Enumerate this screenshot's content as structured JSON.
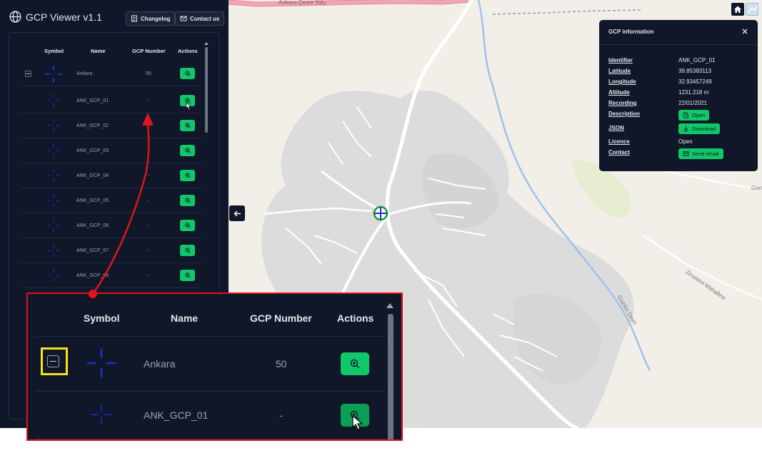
{
  "app": {
    "title": "GCP Viewer v1.1",
    "changelog_label": "Changelog",
    "contact_label": "Contact us"
  },
  "table": {
    "headers": [
      "Symbol",
      "Name",
      "GCP Number",
      "Actions"
    ],
    "group": {
      "name": "Ankara",
      "count": "50",
      "expanded": true
    },
    "rows": [
      {
        "name": "ANK_GCP_01",
        "number": "-"
      },
      {
        "name": "ANK_GCP_02",
        "number": "-"
      },
      {
        "name": "ANK_GCP_03",
        "number": "-"
      },
      {
        "name": "ANK_GCP_04",
        "number": "-"
      },
      {
        "name": "ANK_GCP_05",
        "number": "-"
      },
      {
        "name": "ANK_GCP_06",
        "number": "-"
      },
      {
        "name": "ANK_GCP_07",
        "number": "-"
      },
      {
        "name": "ANK_GCP_08",
        "number": "-"
      }
    ]
  },
  "map": {
    "road_label": "Ankara Çevre Yolu",
    "street_label_1": "Zirvetevi Mahallesi",
    "street_label_2": "Gaziler Devri",
    "street_label_3": "Gem"
  },
  "info": {
    "title": "GCP information",
    "fields": {
      "identifier_label": "Identifier",
      "identifier": "ANK_GCP_01",
      "latitude_label": "Latitude",
      "latitude": "39.85383113",
      "longitude_label": "Longitude",
      "longitude": "32.93457249",
      "altitude_label": "Altitude",
      "altitude": "1231.218 m",
      "recording_label": "Recording",
      "recording": "22/01/2021",
      "description_label": "Description",
      "description_btn": "Open",
      "json_label": "JSON",
      "json_btn": "Download",
      "licence_label": "Licence",
      "licence": "Open",
      "contact_label": "Contact",
      "contact_btn": "Send email"
    }
  },
  "colors": {
    "panel_bg": "#0f1729",
    "accent_green": "#10c86a",
    "symbol_blue": "#1a2fd6",
    "callout_red": "#e0141e",
    "highlight_yellow": "#f5e418"
  },
  "icons": [
    "globe-icon",
    "changelog-icon",
    "mail-icon",
    "zoom-in-icon",
    "arrow-left-icon",
    "home-icon",
    "basemap-icon",
    "close-icon",
    "file-open-icon",
    "download-icon",
    "crosshair-icon",
    "minus-icon"
  ]
}
